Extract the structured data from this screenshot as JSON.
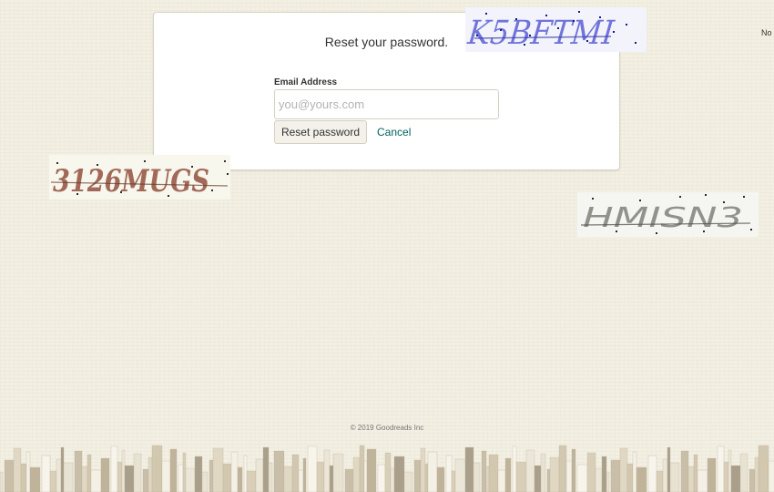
{
  "reset_form": {
    "title": "Reset your password.",
    "email_label": "Email Address",
    "email_value": "",
    "email_placeholder": "you@yours.com",
    "submit_label": "Reset password",
    "cancel_label": "Cancel"
  },
  "top_right_text": "No",
  "footer": {
    "copyright": "© 2019 Goodreads Inc"
  },
  "captchas": [
    {
      "name": "captcha-top",
      "text": "K5BFTMI",
      "color": "#5b5fd6"
    },
    {
      "name": "captcha-left",
      "text": "3126MUGS",
      "color": "#9b5a48"
    },
    {
      "name": "captcha-right",
      "text": "HMISN3",
      "color": "#8d8d88"
    }
  ],
  "colors": {
    "page_background": "#f2efe3",
    "link": "#00635d",
    "button_background": "#f4f1ea",
    "card_border": "#d8d2c4"
  }
}
